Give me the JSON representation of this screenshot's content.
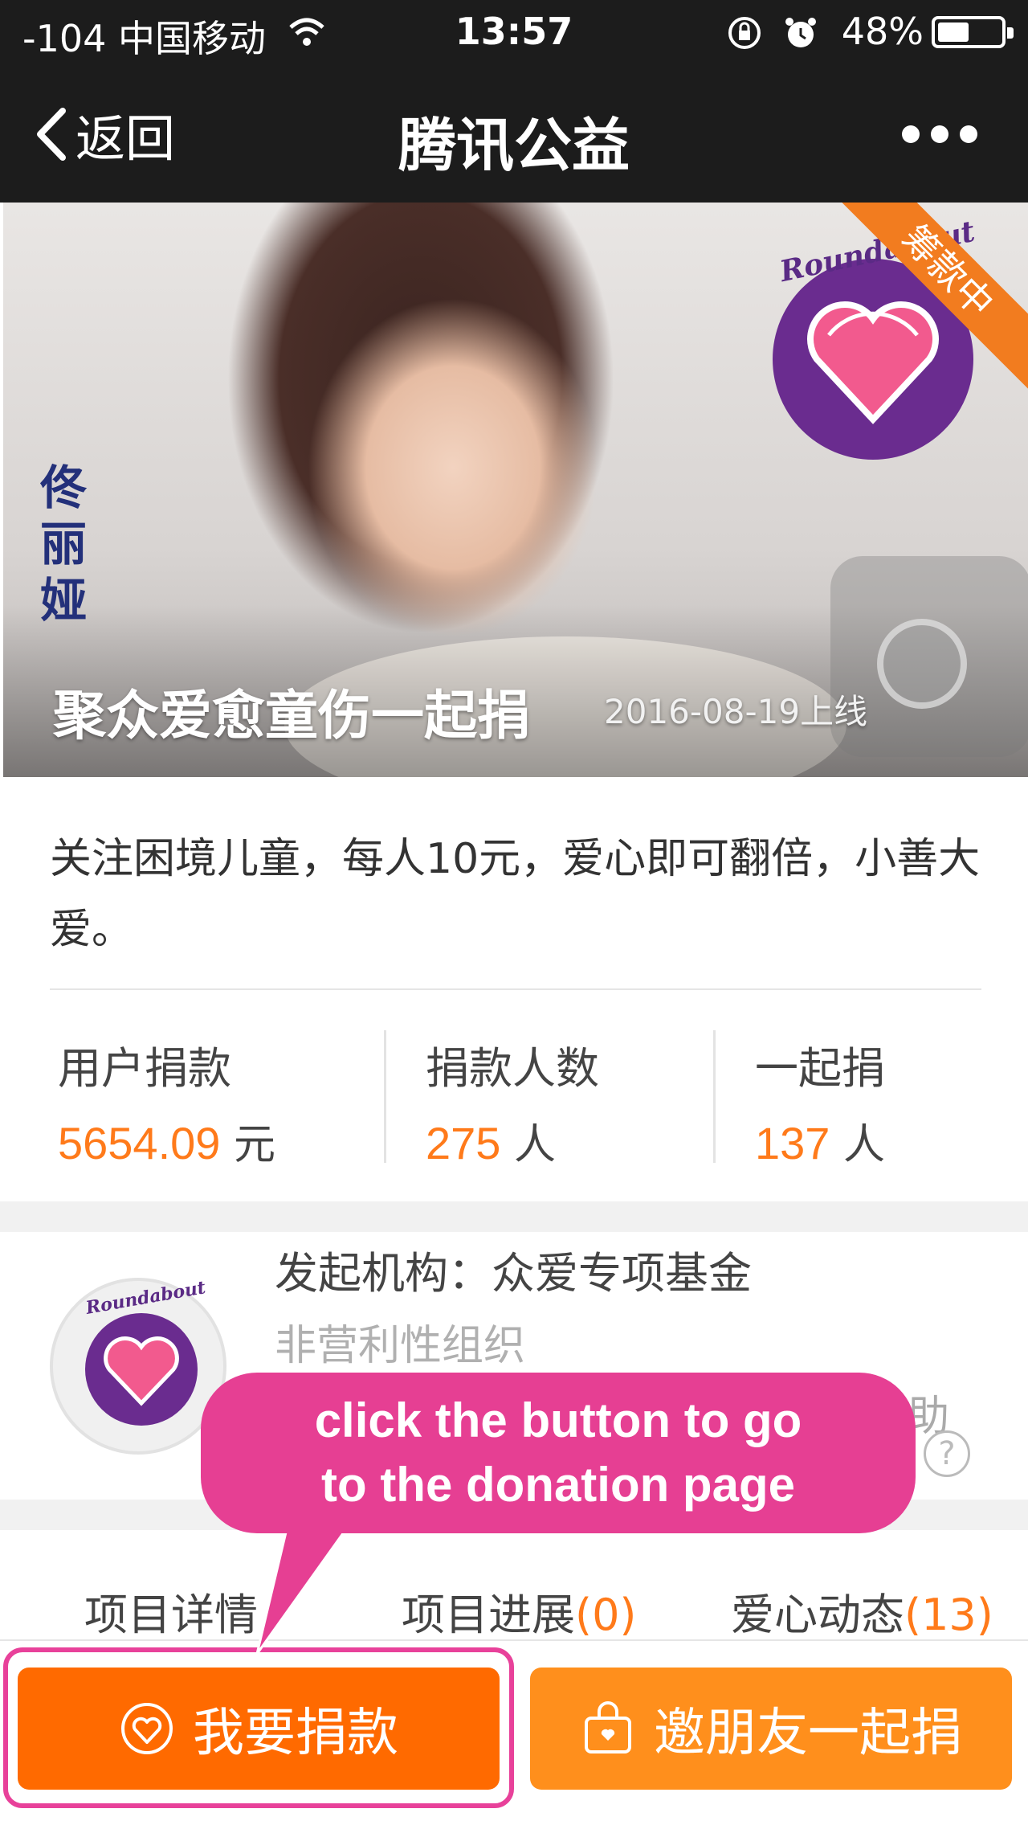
{
  "status_bar": {
    "carrier": "-104 中国移动",
    "time": "13:57",
    "battery": "48%",
    "battery_level": 0.48
  },
  "nav": {
    "back_label": "返回",
    "title": "腾讯公益"
  },
  "banner": {
    "calligraphy": [
      "佟",
      "丽",
      "娅"
    ],
    "logo_text": "Roundabout",
    "ribbon": "筹款中",
    "project_title": "聚众爱愈童伤一起捐",
    "launch_date": "2016-08-19上线"
  },
  "description": "关注困境儿童，每人10元，爱心即可翻倍，小善大爱。",
  "stats": [
    {
      "label": "用户捐款",
      "value": "5654.09",
      "unit": "元"
    },
    {
      "label": "捐款人数",
      "value": "275",
      "unit": "人"
    },
    {
      "label": "一起捐",
      "value": "137",
      "unit": "人"
    }
  ],
  "organization": {
    "name": "发起机构：众爱专项基金",
    "type": "非营利性组织",
    "logo_text": "Roundabout",
    "help_text": "助",
    "help_icon": "?"
  },
  "tabs": [
    {
      "label": "项目详情",
      "count": ""
    },
    {
      "label": "项目进展",
      "count": "(0)"
    },
    {
      "label": "爱心动态",
      "count": "(13)"
    }
  ],
  "buttons": {
    "donate": "我要捐款",
    "invite": "邀朋友一起捐"
  },
  "annotation": {
    "line1": "click the button to go",
    "line2": "to the donation page"
  },
  "colors": {
    "accent_orange": "#ff6a00",
    "callout_pink": "#e63f93",
    "logo_purple": "#6a2c8f"
  }
}
